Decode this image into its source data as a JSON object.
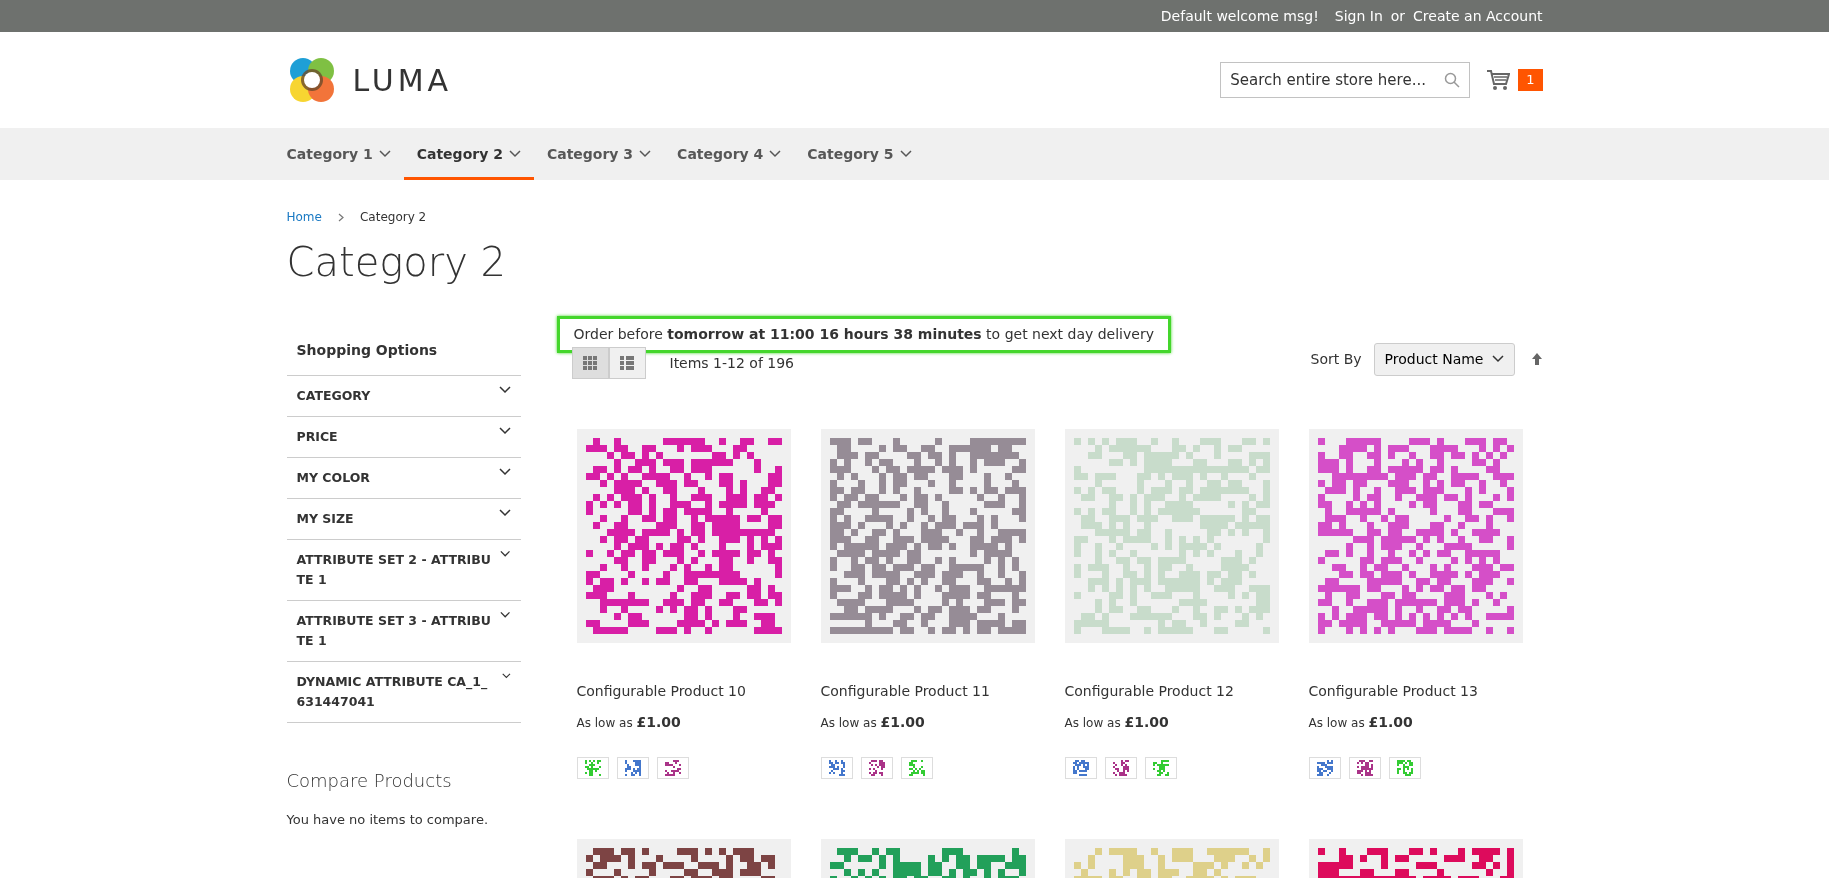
{
  "top_bar": {
    "welcome": "Default welcome msg!",
    "sign_in": "Sign In",
    "separator": "or",
    "create_account": "Create an Account"
  },
  "header": {
    "logo_text": "LUMA",
    "search": {
      "placeholder": "Search entire store here..."
    },
    "cart_count": "1"
  },
  "nav": [
    {
      "label": "Category 1",
      "selected": false
    },
    {
      "label": "Category 2",
      "selected": true
    },
    {
      "label": "Category 3",
      "selected": false
    },
    {
      "label": "Category 4",
      "selected": false
    },
    {
      "label": "Category 5",
      "selected": false
    }
  ],
  "breadcrumbs": [
    {
      "label": "Home",
      "link": true
    },
    {
      "label": "Category 2",
      "link": false
    }
  ],
  "page_title": "Category 2",
  "sidebar": {
    "title": "Shopping Options",
    "filters": [
      {
        "label": "CATEGORY",
        "expanded": false
      },
      {
        "label": "PRICE",
        "expanded": false
      },
      {
        "label": "MY COLOR",
        "expanded": false
      },
      {
        "label": "MY SIZE",
        "expanded": false
      },
      {
        "label": "ATTRIBUTE SET 2 - ATTRIBU TE 1",
        "expanded": false
      },
      {
        "label": "ATTRIBUTE SET 3 - ATTRIBU TE 1",
        "expanded": false
      },
      {
        "label": "DYNAMIC ATTRIBUTE CA_1_ 631447041",
        "expanded": false
      }
    ],
    "compare_title": "Compare Products",
    "compare_text": "You have no items to compare."
  },
  "notice": "Order before **tomorrow at 11:00 16 hours 38 minutes** to get next day delivery",
  "toolbar": {
    "views": [
      {
        "kind": "grid",
        "selected": true
      },
      {
        "kind": "list",
        "selected": false
      }
    ],
    "items_text": "Items 1-12 of 196",
    "sort_label": "Sort By",
    "sort_value": "Product Name"
  },
  "products": [
    {
      "name": "Configurable Product 10",
      "price_prefix": "As low as",
      "price": "£1.00",
      "color": "#d81fa6",
      "swatches": [
        {
          "color": "#33cc33"
        },
        {
          "color": "#4477cc"
        },
        {
          "color": "#aa3388"
        }
      ]
    },
    {
      "name": "Configurable Product 11",
      "price_prefix": "As low as",
      "price": "£1.00",
      "color": "#968c96",
      "swatches": [
        {
          "color": "#4477cc"
        },
        {
          "color": "#aa3388"
        },
        {
          "color": "#33cc33"
        }
      ]
    },
    {
      "name": "Configurable Product 12",
      "price_prefix": "As low as",
      "price": "£1.00",
      "color": "#c8dccb",
      "swatches": [
        {
          "color": "#4477cc"
        },
        {
          "color": "#aa3388"
        },
        {
          "color": "#33cc33"
        }
      ]
    },
    {
      "name": "Configurable Product 13",
      "price_prefix": "As low as",
      "price": "£1.00",
      "color": "#d54fc8",
      "swatches": [
        {
          "color": "#4477cc"
        },
        {
          "color": "#aa3388"
        },
        {
          "color": "#33cc33"
        }
      ]
    }
  ],
  "more_products": [
    {
      "color": "#7d4444"
    },
    {
      "color": "#22a05a"
    },
    {
      "color": "#ded08a"
    },
    {
      "color": "#dd0b5c"
    }
  ]
}
